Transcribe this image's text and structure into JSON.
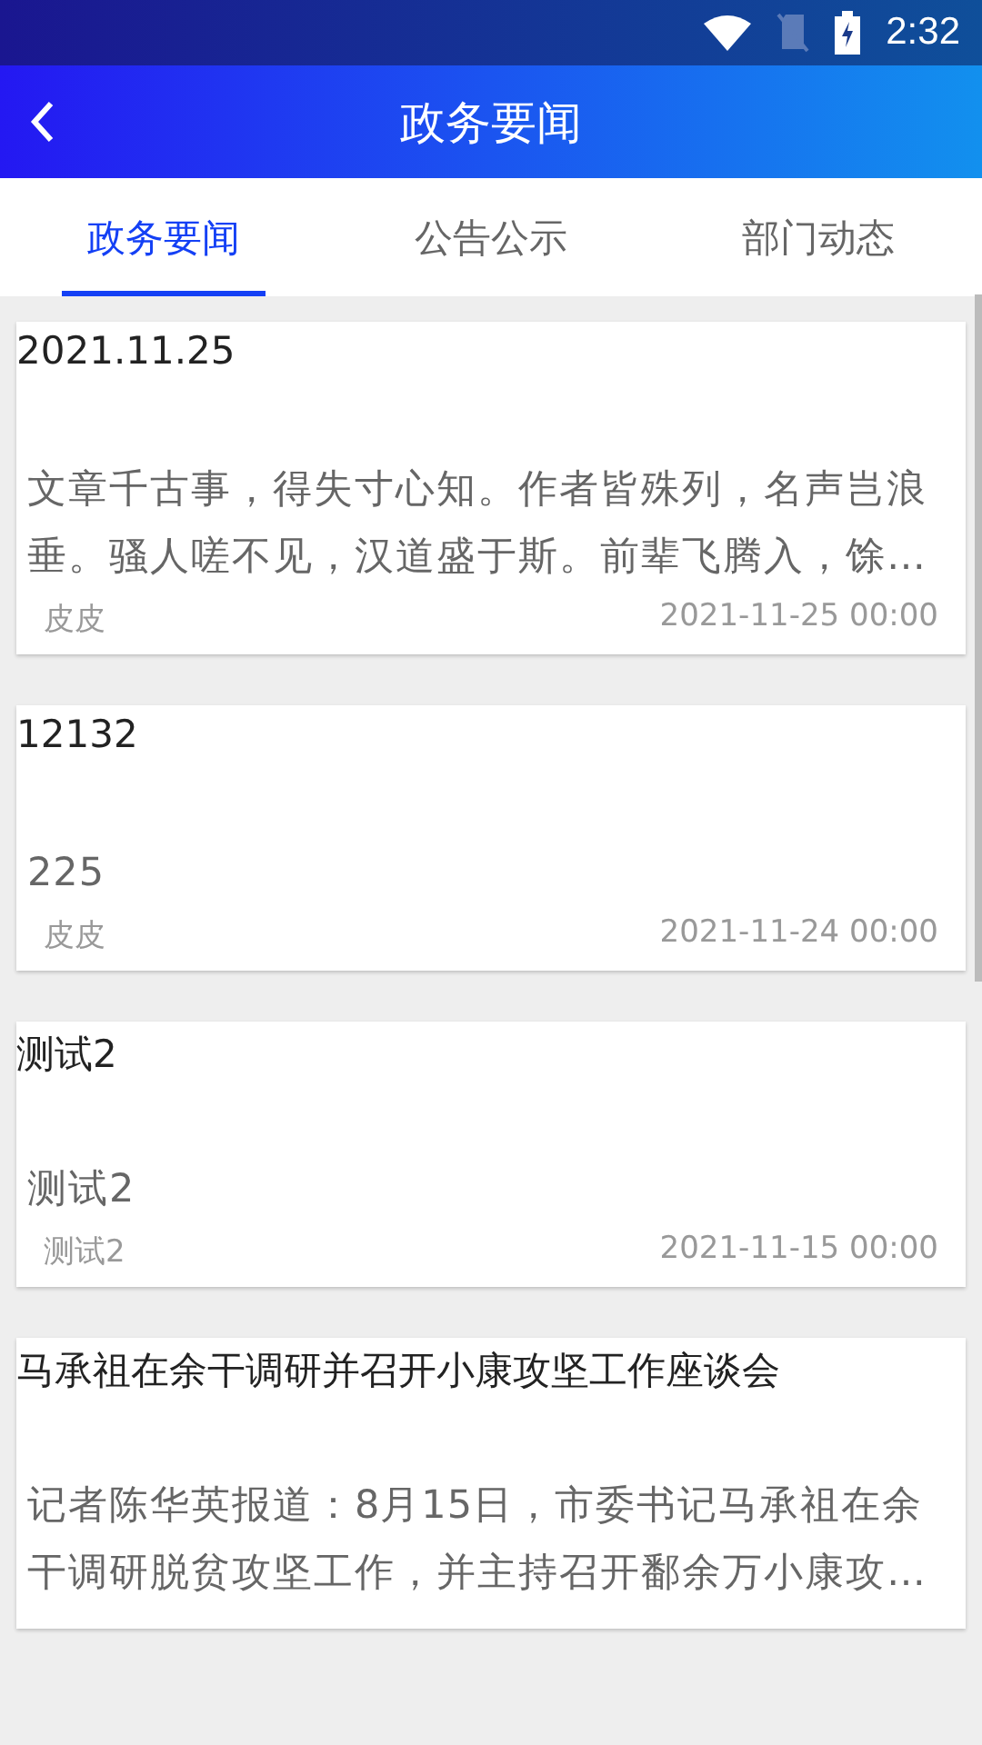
{
  "status_bar": {
    "time": "2:32"
  },
  "header": {
    "title": "政务要闻"
  },
  "tabs": [
    {
      "label": "政务要闻",
      "selected": true
    },
    {
      "label": "公告公示",
      "selected": false
    },
    {
      "label": "部门动态",
      "selected": false
    }
  ],
  "articles": [
    {
      "title": "2021.11.25",
      "summary": "文章千古事，得失寸心知。作者皆殊列，名声岂浪垂。骚人嗟不见，汉道盛于斯。前辈飞腾入，馀…",
      "author": "皮皮",
      "time": "2021-11-25 00:00"
    },
    {
      "title": "12132",
      "summary": "225",
      "author": "皮皮",
      "time": "2021-11-24 00:00"
    },
    {
      "title": "测试2",
      "summary": "测试2",
      "author": "测试2",
      "time": "2021-11-15 00:00"
    },
    {
      "title": "马承祖在余干调研并召开小康攻坚工作座谈会",
      "summary": "记者陈华英报道：8月15日，市委书记马承祖在余干调研脱贫攻坚工作，并主持召开鄱余万小康攻…"
    }
  ]
}
